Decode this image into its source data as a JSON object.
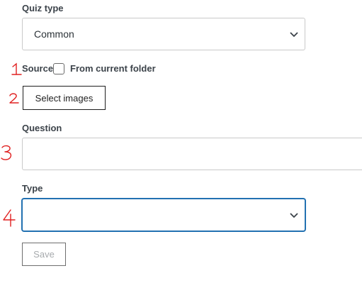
{
  "quiz_type": {
    "label": "Quiz type",
    "selected": "Common"
  },
  "source": {
    "label": "Source",
    "checkbox_label": "From current folder",
    "checked": false
  },
  "select_images_button": "Select images",
  "question": {
    "label": "Question",
    "value": ""
  },
  "type": {
    "label": "Type",
    "selected": ""
  },
  "save_button": "Save",
  "annotations": [
    "1",
    "2",
    "3",
    "4"
  ],
  "colors": {
    "annotation": "#e02020",
    "focus": "#2271b1",
    "label": "#3c434a"
  }
}
